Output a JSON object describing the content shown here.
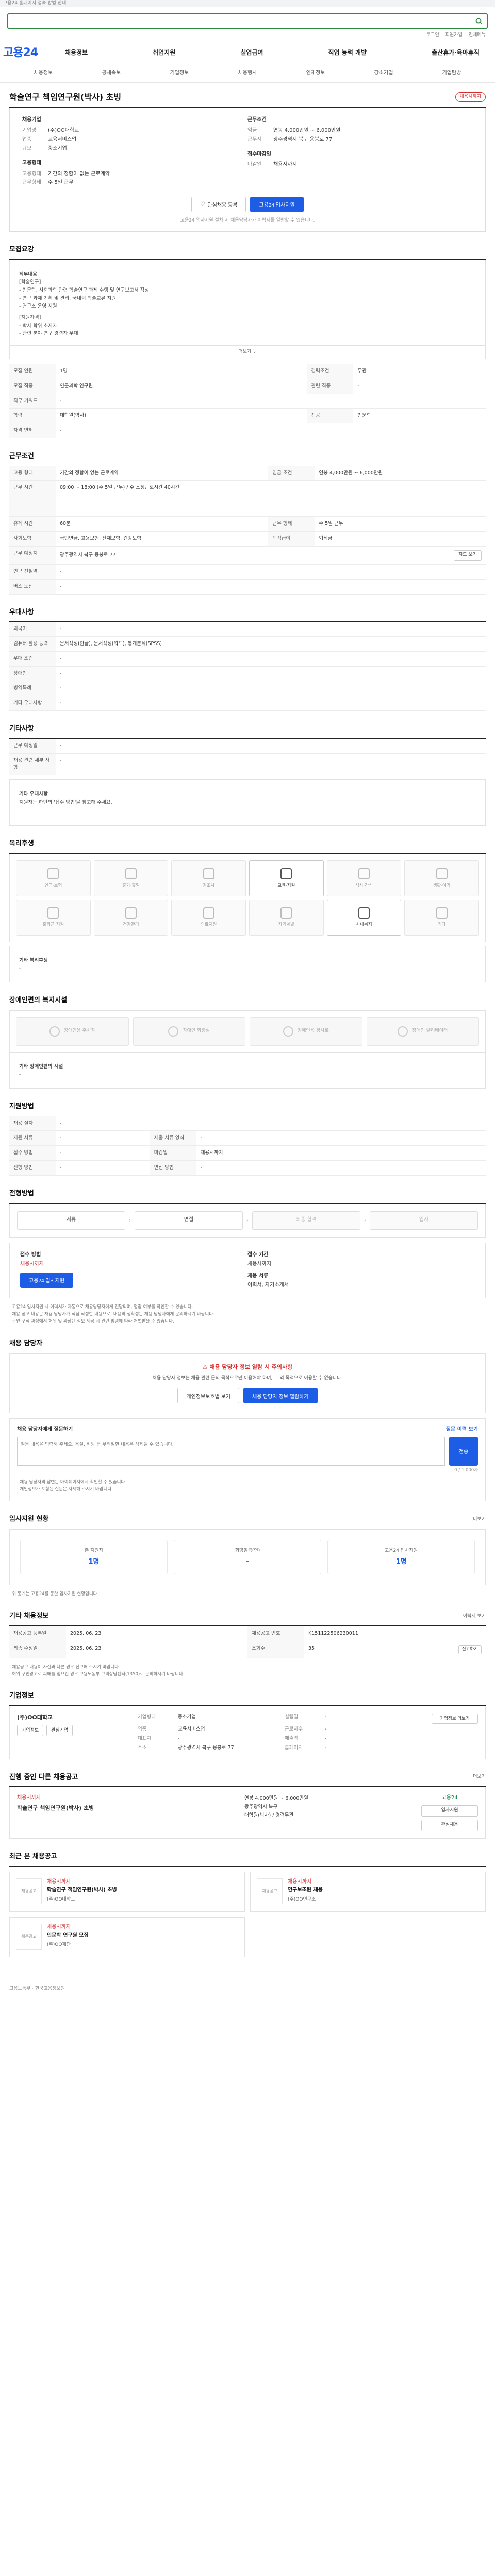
{
  "topbar": {
    "notice": "고용24 홈페이지 접속 방법 안내"
  },
  "search": {
    "placeholder": ""
  },
  "util": [
    "로그인",
    "회원가입",
    "전체메뉴"
  ],
  "nav": {
    "logo": "고용24",
    "menu": [
      "채용정보",
      "취업지원",
      "실업급여",
      "직업 능력 개발",
      "출산휴가·육아휴직"
    ]
  },
  "subnav": [
    "채용정보",
    "공채속보",
    "기업정보",
    "채용행사",
    "인재정보",
    "강소기업",
    "기업탐방"
  ],
  "job": {
    "title": "학술연구 책임연구원(박사) 초빙",
    "status": "채용시까지",
    "company_label": "채용기업",
    "company_name": "(주)OO대학교",
    "kv_left": [
      {
        "k": "업종",
        "v": "교육서비스업"
      },
      {
        "k": "규모",
        "v": "중소기업"
      }
    ],
    "employ_label": "고용형태",
    "kv_left2": [
      {
        "k": "고용형태",
        "v": "기간의 정함이 없는 근로계약"
      },
      {
        "k": "근무형태",
        "v": "주 5일 근무"
      }
    ],
    "cond_label": "근무조건",
    "kv_right": [
      {
        "k": "임금",
        "v": "연봉 4,000만원 ~ 6,000만원"
      },
      {
        "k": "근무지",
        "v": "광주광역시 북구 용봉로 77"
      }
    ],
    "deadline_label": "접수마감일",
    "kv_right2": [
      {
        "k": "마감일",
        "v": "채용시까지"
      }
    ],
    "btn_scrap": "관심채용 등록",
    "btn_apply": "고용24 입사지원",
    "notice": "고용24 입사지원 절차 시 채용담당자가 이력서를 열람할 수 있습니다."
  },
  "sections": {
    "recruit": "모집요강",
    "condition": "근무조건",
    "preference": "우대사항",
    "other": "기타사항",
    "welfare": "복리후생",
    "disability": "장애인편의 복지시설",
    "apply": "지원방법",
    "process": "전형방법",
    "contact": "채용 담당자",
    "stats": "입사지원 현황",
    "info": "기타 채용정보",
    "corp": "기업정보",
    "rec": "진행 중인 다른 채용공고",
    "recent": "최근 본 채용공고"
  },
  "recruit": {
    "desc_title": "직무내용",
    "desc_lines": [
      "[학술연구]",
      "- 인문학, 사회과학 관련 학술연구 과제 수행 및 연구보고서 작성",
      "- 연구 과제 기획 및 관리, 국내외 학술교류 지원",
      "- 연구소 운영 지원",
      "[지원자격]",
      "- 박사 학위 소지자",
      "- 관련 분야 연구 경력자 우대"
    ],
    "toggle": "더보기",
    "rows": [
      {
        "k": "모집 인원",
        "v": "1명",
        "k2": "경력조건",
        "v2": "무관"
      },
      {
        "k": "모집 직종",
        "v": "인문과학 연구원",
        "k2": "관련 직종",
        "v2": "-"
      },
      {
        "k": "직무 키워드",
        "v": "-",
        "k2": "",
        "v2": ""
      },
      {
        "k": "학력",
        "v": "대학원(박사)",
        "k2": "전공",
        "v2": "인문학"
      },
      {
        "k": "자격 면허",
        "v": "-",
        "k2": "",
        "v2": ""
      }
    ]
  },
  "condition": {
    "rows": [
      {
        "k": "고용 형태",
        "v": "기간의 정함이 없는 근로계약",
        "k2": "임금 조건",
        "v2": "연봉 4,000만원 ~ 6,000만원"
      },
      {
        "k": "근무 시간",
        "v": "09:00 ~ 18:00 (주 5일 근무) / 주 소정근로시간 40시간",
        "k2": "",
        "v2": ""
      },
      {
        "k": "휴게 시간",
        "v": "60분",
        "k2": "근무 형태",
        "v2": "주 5일 근무"
      },
      {
        "k": "사회보험",
        "v": "국민연금, 고용보험, 산재보험, 건강보험",
        "k2": "퇴직급여",
        "v2": "퇴직금"
      },
      {
        "k": "근무 예정지",
        "v": "광주광역시 북구 용봉로 77",
        "k2": "",
        "v2": ""
      },
      {
        "k": "인근 전철역",
        "v": "-",
        "k2": "",
        "v2": ""
      },
      {
        "k": "버스 노선",
        "v": "-",
        "k2": "",
        "v2": ""
      }
    ],
    "map_btn": "지도 보기"
  },
  "preference": {
    "rows": [
      {
        "k": "외국어",
        "v": "-"
      },
      {
        "k": "컴퓨터 활용 능력",
        "v": "문서작성(한글), 문서작성(워드), 통계분석(SPSS)"
      },
      {
        "k": "우대 조건",
        "v": "-"
      },
      {
        "k": "장애인",
        "v": "-"
      },
      {
        "k": "병역특례",
        "v": "-"
      },
      {
        "k": "기타 우대사항",
        "v": "-"
      }
    ]
  },
  "other": {
    "rows": [
      {
        "k": "근무 예정일",
        "v": "-"
      },
      {
        "k": "채용 관련 세부 사항",
        "v": "-"
      }
    ],
    "note_title": "기타 우대사항",
    "note": "지원자는 하단의 '접수 방법'을 참고해 주세요."
  },
  "welfare": {
    "items": [
      {
        "label": "연금·보험",
        "on": false
      },
      {
        "label": "휴가·휴일",
        "on": false
      },
      {
        "label": "경조사",
        "on": false
      },
      {
        "label": "교육·지원",
        "on": true
      },
      {
        "label": "식사·간식",
        "on": false
      },
      {
        "label": "생활·여가",
        "on": false
      },
      {
        "label": "출퇴근 지원",
        "on": false
      },
      {
        "label": "건강관리",
        "on": false
      },
      {
        "label": "의료지원",
        "on": false
      },
      {
        "label": "자기계발",
        "on": false
      },
      {
        "label": "사내복지",
        "on": true
      },
      {
        "label": "기타",
        "on": false
      }
    ],
    "extra_title": "기타 복리후생",
    "extra": "-"
  },
  "disability": {
    "items": [
      "장애인용 주차장",
      "장애인 화장실",
      "장애인용 경사로",
      "장애인 엘리베이터"
    ],
    "extra_title": "기타 장애인편의 시설",
    "extra": "-"
  },
  "apply": {
    "rows": [
      {
        "k": "채용 절차",
        "v": "-"
      },
      {
        "k": "지원 서류",
        "v": "-",
        "k2": "제출 서류 양식",
        "v2": "-"
      },
      {
        "k": "접수 방법",
        "v": "-",
        "k2": "마감일",
        "v2": "채용시까지"
      },
      {
        "k": "전형 방법",
        "v": "-",
        "k2": "면접 방법",
        "v2": "-"
      }
    ]
  },
  "process": {
    "steps": [
      {
        "label": "서류",
        "dim": false
      },
      {
        "label": "면접",
        "dim": false
      },
      {
        "label": "최종 합격",
        "dim": true
      },
      {
        "label": "입사",
        "dim": true
      }
    ]
  },
  "applybox": {
    "left_label": "접수 방법",
    "left_value": "채용시까지",
    "left_btn": "고용24 입사지원",
    "right_label": "접수 기간",
    "right_value": "채용시까지",
    "right_label2": "채용 서류",
    "right_value2": "이력서, 자기소개서"
  },
  "apply_notes": [
    "· 고용24 입사지원 시 이력서가 자동으로 채용담당자에게 전달되며, 열람 여부를 확인할 수 있습니다.",
    "· 채용 공고 내용은 채용 담당자가 직접 작성한 내용으로, 내용의 정확성은 채용 담당자에게 문의하시기 바랍니다.",
    "· 구인·구직 과정에서 허위 및 과장된 정보 제공 시 관련 법령에 따라 처벌받을 수 있습니다."
  ],
  "contact": {
    "warn_title": "채용 담당자 정보 열람 시 주의사항",
    "warn_text": "채용 담당자 정보는 채용 관련 문의 목적으로만 이용해야 하며, 그 외 목적으로 이용할 수 없습니다.",
    "warn_btn1": "개인정보보호법 보기",
    "warn_btn2": "채용 담당자 정보 열람하기",
    "qa_title": "채용 담당자에게 질문하기",
    "qa_right": "질문 이력 보기",
    "qa_placeholder": "질문 내용을 입력해 주세요. 욕설, 비방 등 부적절한 내용은 삭제될 수 있습니다.",
    "qa_send": "전송",
    "qa_count": "0 / 1,000자",
    "qa_notes": [
      "· 채용 담당자의 답변은 마이페이지에서 확인할 수 있습니다.",
      "· 개인정보가 포함된 질문은 자제해 주시기 바랍니다."
    ]
  },
  "stats": {
    "more": "더보기",
    "items": [
      {
        "label": "총 지원자",
        "value": "1명"
      },
      {
        "label": "희망임금(연)",
        "value": "-"
      },
      {
        "label": "고용24 입사지원",
        "value": "1명"
      }
    ],
    "note": "· 위 통계는 고용24를 통한 입사지원 현황입니다."
  },
  "info": {
    "more": "이력서 보기",
    "cells": [
      {
        "k": "채용공고 등록일",
        "v": "2025. 06. 23"
      },
      {
        "k": "채용공고 번호",
        "v": "K151122506230011"
      },
      {
        "k": "최종 수정일",
        "v": "2025. 06. 23"
      },
      {
        "k": "조회수",
        "v": "35"
      }
    ],
    "notes": [
      "· 채용공고 내용이 사실과 다른 경우 신고해 주시기 바랍니다.",
      "· 허위 구인광고로 피해를 입으신 경우 고용노동부 고객상담센터(1350)로 문의하시기 바랍니다."
    ],
    "report_btn": "신고하기"
  },
  "corp": {
    "name": "(주)OO대학교",
    "btn1": "기업정보",
    "btn2": "관심기업",
    "rows": [
      {
        "k": "기업형태",
        "v": "중소기업",
        "k2": "설립일",
        "v2": "-"
      },
      {
        "k": "업종",
        "v": "교육서비스업",
        "k2": "근로자수",
        "v2": "-"
      },
      {
        "k": "대표자",
        "v": "-",
        "k2": "매출액",
        "v2": "-"
      },
      {
        "k": "주소",
        "v": "광주광역시 북구 용봉로 77",
        "k2": "홈페이지",
        "v2": "-"
      }
    ],
    "more_btn": "기업정보 더보기"
  },
  "rec": {
    "more": "더보기",
    "status": "채용시까지",
    "title": "학술연구 책임연구원(박사) 초빙",
    "lines": [
      "연봉 4,000만원 ~ 6,000만원",
      "광주광역시 북구",
      "대학원(박사) / 경력무관"
    ],
    "badge": "고용24",
    "btn1": "입사지원",
    "btn2": "관심채용"
  },
  "recent": {
    "posts": [
      {
        "thumb": "채용공고",
        "tag": "채용시까지",
        "title": "학술연구 책임연구원(박사) 초빙",
        "co": "(주)OO대학교"
      },
      {
        "thumb": "채용공고",
        "tag": "채용시까지",
        "title": "연구보조원 채용",
        "co": "(주)OO연구소"
      },
      {
        "thumb": "채용공고",
        "tag": "채용시까지",
        "title": "인문학 연구원 모집",
        "co": "(주)OO재단"
      }
    ]
  },
  "footer": {
    "text": "고용노동부 · 한국고용정보원"
  }
}
